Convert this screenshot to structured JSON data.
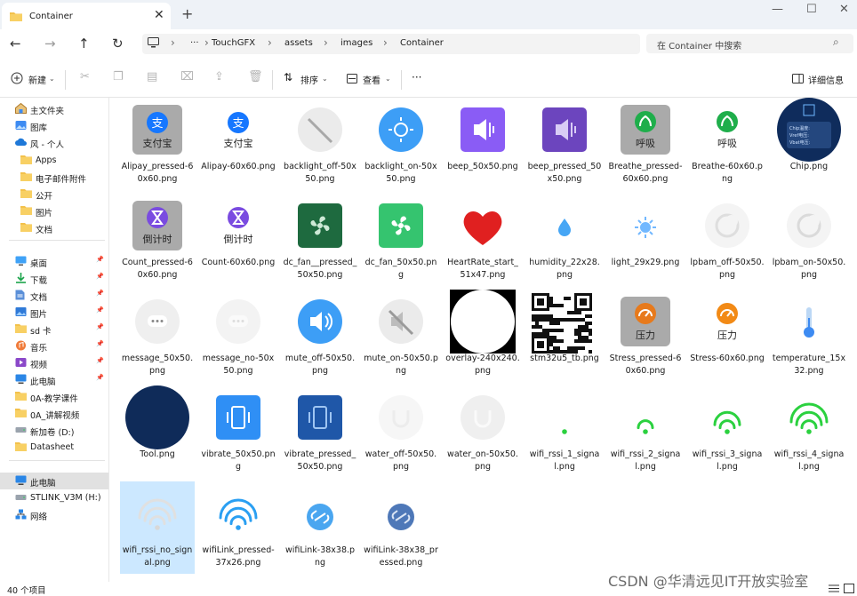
{
  "window": {
    "tab_title": "Container",
    "new_tab": "+",
    "close_tab": "✕",
    "minimize": "—",
    "maximize": "☐",
    "close": "✕"
  },
  "address": {
    "more": "···",
    "crumbs": [
      "TouchGFX",
      "assets",
      "images",
      "Container"
    ],
    "sep": "›",
    "search_placeholder": "在 Container 中搜索"
  },
  "toolbar": {
    "new_label": "新建",
    "sort_label": "排序",
    "view_label": "查看",
    "more_label": "···",
    "details_label": "详细信息"
  },
  "sidebar": {
    "items": [
      {
        "label": "主文件夹",
        "icon": "home-icon"
      },
      {
        "label": "图库",
        "icon": "gallery-icon"
      },
      {
        "label": "风 - 个人",
        "icon": "cloud-icon"
      },
      {
        "label": "Apps",
        "icon": "folder-icon"
      },
      {
        "label": "电子邮件附件",
        "icon": "folder-icon"
      },
      {
        "label": "公开",
        "icon": "folder-icon"
      },
      {
        "label": "图片",
        "icon": "folder-icon"
      },
      {
        "label": "文档",
        "icon": "folder-icon"
      },
      {
        "label": "桌面",
        "icon": "desktop-icon"
      },
      {
        "label": "下载",
        "icon": "download-icon"
      },
      {
        "label": "文档",
        "icon": "documents-icon"
      },
      {
        "label": "图片",
        "icon": "pictures-icon"
      },
      {
        "label": "sd 卡",
        "icon": "folder-icon"
      },
      {
        "label": "音乐",
        "icon": "music-icon"
      },
      {
        "label": "视频",
        "icon": "video-icon"
      },
      {
        "label": "此电脑",
        "icon": "pc-icon"
      },
      {
        "label": "0A-教学课件",
        "icon": "folder-icon"
      },
      {
        "label": "0A_讲解视频",
        "icon": "folder-icon"
      },
      {
        "label": "新加卷 (D:)",
        "icon": "drive-icon"
      },
      {
        "label": "Datasheet",
        "icon": "folder-icon"
      },
      {
        "label": "此电脑",
        "icon": "pc-icon"
      },
      {
        "label": "STLINK_V3M (H:)",
        "icon": "drive-icon"
      },
      {
        "label": "网络",
        "icon": "network-icon"
      }
    ]
  },
  "files": [
    {
      "name": "Alipay_pressed-60x60.png",
      "icon": "alipay-pressed-thumb",
      "text": "支付宝"
    },
    {
      "name": "Alipay-60x60.png",
      "icon": "alipay-thumb",
      "text": "支付宝"
    },
    {
      "name": "backlight_off-50x50.png",
      "icon": "backlight-off-thumb"
    },
    {
      "name": "backlight_on-50x50.png",
      "icon": "backlight-on-thumb"
    },
    {
      "name": "beep_50x50.png",
      "icon": "beep-thumb"
    },
    {
      "name": "beep_pressed_50x50.png",
      "icon": "beep-pressed-thumb"
    },
    {
      "name": "Breathe_pressed-60x60.png",
      "icon": "breathe-pressed-thumb",
      "text": "呼吸"
    },
    {
      "name": "Breathe-60x60.png",
      "icon": "breathe-thumb",
      "text": "呼吸"
    },
    {
      "name": "Chip.png",
      "icon": "chip-thumb",
      "lines": [
        "Chip温度:",
        "Vref电压:",
        "Vbat电压:"
      ]
    },
    {
      "name": "Count_pressed-60x60.png",
      "icon": "count-pressed-thumb",
      "text": "倒计时"
    },
    {
      "name": "Count-60x60.png",
      "icon": "count-thumb",
      "text": "倒计时"
    },
    {
      "name": "dc_fan__pressed_50x50.png",
      "icon": "fan-pressed-thumb"
    },
    {
      "name": "dc_fan_50x50.png",
      "icon": "fan-thumb"
    },
    {
      "name": "HeartRate_start_51x47.png",
      "icon": "heart-thumb"
    },
    {
      "name": "humidity_22x28.png",
      "icon": "humidity-thumb"
    },
    {
      "name": "light_29x29.png",
      "icon": "light-thumb"
    },
    {
      "name": "lpbam_off-50x50.png",
      "icon": "lpbam-off-thumb"
    },
    {
      "name": "lpbam_on-50x50.png",
      "icon": "lpbam-on-thumb"
    },
    {
      "name": "message_50x50.png",
      "icon": "message-thumb"
    },
    {
      "name": "message_no-50x50.png",
      "icon": "message-no-thumb"
    },
    {
      "name": "mute_off-50x50.png",
      "icon": "mute-off-thumb"
    },
    {
      "name": "mute_on-50x50.png",
      "icon": "mute-on-thumb"
    },
    {
      "name": "overlay-240x240.png",
      "icon": "overlay-thumb"
    },
    {
      "name": "stm32u5_tb.png",
      "icon": "qrcode-thumb"
    },
    {
      "name": "Stress_pressed-60x60.png",
      "icon": "stress-pressed-thumb",
      "text": "压力"
    },
    {
      "name": "Stress-60x60.png",
      "icon": "stress-thumb",
      "text": "压力"
    },
    {
      "name": "temperature_15x32.png",
      "icon": "thermometer-thumb"
    },
    {
      "name": "Tool.png",
      "icon": "tool-thumb"
    },
    {
      "name": "vibrate_50x50.png",
      "icon": "vibrate-thumb"
    },
    {
      "name": "vibrate_pressed_50x50.png",
      "icon": "vibrate-pressed-thumb"
    },
    {
      "name": "water_off-50x50.png",
      "icon": "water-off-thumb"
    },
    {
      "name": "water_on-50x50.png",
      "icon": "water-on-thumb"
    },
    {
      "name": "wifi_rssi_1_signal.png",
      "icon": "wifi1-thumb"
    },
    {
      "name": "wifi_rssi_2_signal.png",
      "icon": "wifi2-thumb"
    },
    {
      "name": "wifi_rssi_3_signal.png",
      "icon": "wifi3-thumb"
    },
    {
      "name": "wifi_rssi_4_signal.png",
      "icon": "wifi4-thumb"
    },
    {
      "name": "wifi_rssi_no_signal.png",
      "icon": "wifi-none-thumb"
    },
    {
      "name": "wifiLink_pressed-37x26.png",
      "icon": "wifilink-pressed-thumb"
    },
    {
      "name": "wifiLink-38x38.png",
      "icon": "wifilink-thumb"
    },
    {
      "name": "wifiLink-38x38_pressed.png",
      "icon": "wifilink-38-pressed-thumb"
    }
  ],
  "status": {
    "count": "40 个项目"
  },
  "watermark": "CSDN @华清远见IT开放实验室",
  "colors": {
    "accent": "#0067c0",
    "selection": "#cce8ff",
    "green": "#2bd13f",
    "blue": "#3d8bf2"
  }
}
